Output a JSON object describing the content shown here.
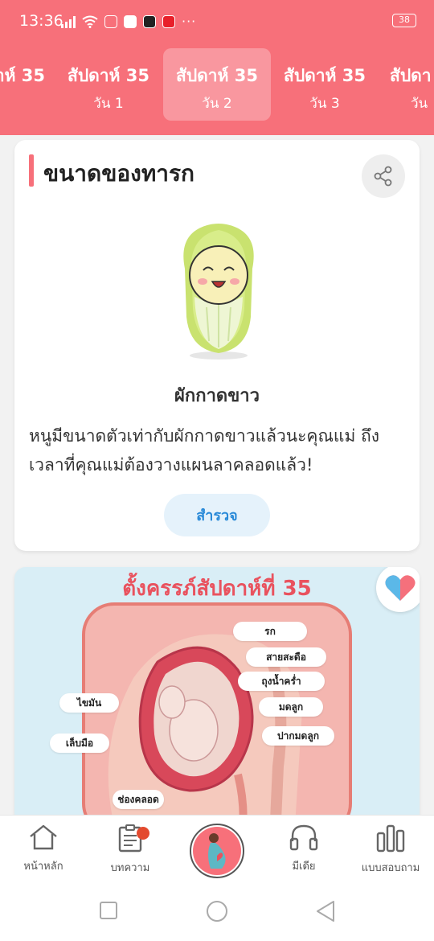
{
  "status_bar": {
    "time": "13:36",
    "battery": "38",
    "more": "···"
  },
  "week_tabs": [
    {
      "title": "าห์ 35",
      "day": ""
    },
    {
      "title": "สัปดาห์ 35",
      "day": "วัน 1"
    },
    {
      "title": "สัปดาห์ 35",
      "day": "วัน 2",
      "active": true
    },
    {
      "title": "สัปดาห์ 35",
      "day": "วัน 3"
    },
    {
      "title": "สัปดา",
      "day": "วัน"
    }
  ],
  "size_card": {
    "title": "ขนาดของทารก",
    "vegetable_name": "ผักกาดขาว",
    "description": "หนูมีขนาดตัวเท่ากับผักกาดขาวแล้วนะคุณแม่ ถึงเวลาที่คุณแม่ต้องวางแผนลาคลอดแล้ว!",
    "explore_label": "สำรวจ"
  },
  "pregnancy_card": {
    "title": "ตั้งครรภ์สัปดาห์ที่ 35",
    "labels": {
      "placenta": "รก",
      "umbilical_cord": "สายสะดือ",
      "amniotic_sac": "ถุงน้ำคร่ำ",
      "uterus": "มดลูก",
      "cervix": "ปากมดลูก",
      "fat": "ไขมัน",
      "fingernails": "เล็บมือ",
      "birth_canal": "ช่องคลอด"
    }
  },
  "bottom_nav": {
    "home": "หน้าหลัก",
    "articles": "บทความ",
    "media": "มีเดีย",
    "survey": "แบบสอบถาม"
  },
  "colors": {
    "header": "#f7707a",
    "accent_blue": "#2a8ad8",
    "title_red": "#e9525e"
  }
}
